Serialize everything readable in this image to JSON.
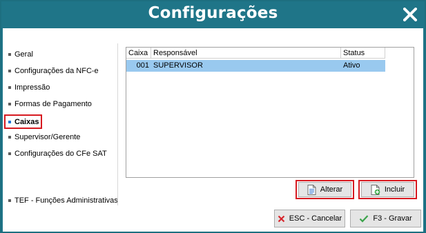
{
  "window": {
    "title": "Configurações"
  },
  "nav": {
    "items": [
      {
        "label": "Geral"
      },
      {
        "label": "Configurações da NFC-e"
      },
      {
        "label": "Impressão"
      },
      {
        "label": "Formas de Pagamento"
      },
      {
        "label": "Caixas",
        "active": true
      },
      {
        "label": "Supervisor/Gerente"
      },
      {
        "label": "Configurações do CFe SAT"
      },
      {
        "label": "TEF - Funções Administrativas"
      }
    ]
  },
  "table": {
    "columns": [
      "Caixa",
      "Responsável",
      "Status"
    ],
    "rows": [
      {
        "caixa": "001",
        "responsavel": "SUPERVISOR",
        "status": "Ativo"
      }
    ]
  },
  "buttons": {
    "alterar": "Alterar",
    "incluir": "Incluir",
    "cancelar": "ESC - Cancelar",
    "gravar": "F3 - Gravar"
  },
  "colors": {
    "titlebar": "#1f7588",
    "selection": "#99c9ef",
    "highlight": "#d71920"
  }
}
